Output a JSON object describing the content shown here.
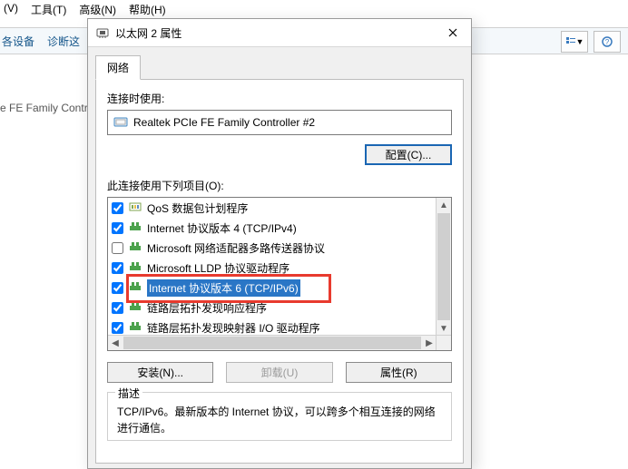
{
  "bg_menu": {
    "view": "(V)",
    "tools": "工具(T)",
    "advanced": "高级(N)",
    "help": "帮助(H)"
  },
  "bg_toolbar": {
    "item1": "各设备",
    "item2": "诊断这"
  },
  "bg_adapter_fragment": "e FE Family Contr",
  "dialog": {
    "title": "以太网 2 属性",
    "tab_network": "网络",
    "connect_using_label": "连接时使用:",
    "adapter_name": "Realtek PCIe FE Family Controller #2",
    "configure_button": "配置(C)...",
    "items_label": "此连接使用下列项目(O):",
    "items": [
      {
        "checked": true,
        "icon": "qos",
        "label": "QoS 数据包计划程序"
      },
      {
        "checked": true,
        "icon": "proto",
        "label": "Internet 协议版本 4 (TCP/IPv4)"
      },
      {
        "checked": false,
        "icon": "proto",
        "label": "Microsoft 网络适配器多路传送器协议"
      },
      {
        "checked": true,
        "icon": "proto",
        "label": "Microsoft LLDP 协议驱动程序"
      },
      {
        "checked": true,
        "icon": "proto",
        "label": "Internet 协议版本 6 (TCP/IPv6)",
        "selected": true
      },
      {
        "checked": true,
        "icon": "proto",
        "label": "链路层拓扑发现响应程序"
      },
      {
        "checked": true,
        "icon": "proto",
        "label": "链路层拓扑发现映射器 I/O 驱动程序"
      }
    ],
    "install_button": "安装(N)...",
    "uninstall_button": "卸载(U)",
    "properties_button": "属性(R)",
    "desc_legend": "描述",
    "desc_text": "TCP/IPv6。最新版本的 Internet 协议，可以跨多个相互连接的网络进行通信。"
  }
}
